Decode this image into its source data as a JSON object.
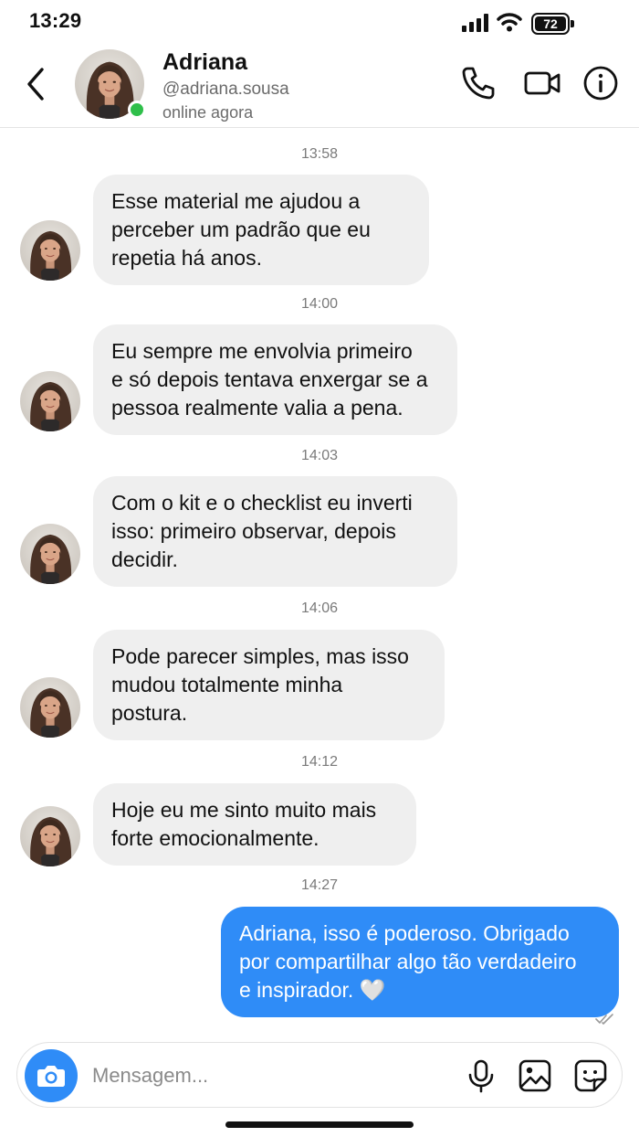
{
  "status_bar": {
    "time": "13:29",
    "battery": "72"
  },
  "header": {
    "name": "Adriana",
    "handle": "@adriana.sousa",
    "status": "online agora"
  },
  "messages": [
    {
      "time": "13:58",
      "direction": "in",
      "lines": [
        "Esse material me ajudou a",
        "perceber um padrão que eu",
        "repetia há anos."
      ]
    },
    {
      "time": "14:00",
      "direction": "in",
      "lines": [
        "Eu sempre me envolvia primeiro",
        "e só depois tentava enxergar se a",
        "pessoa realmente valia a pena."
      ]
    },
    {
      "time": "14:03",
      "direction": "in",
      "lines": [
        "Com o kit e o checklist eu inverti",
        "isso: primeiro observar, depois",
        "decidir."
      ]
    },
    {
      "time": "14:06",
      "direction": "in",
      "lines": [
        "Pode parecer simples, mas isso",
        "mudou totalmente minha",
        "postura."
      ]
    },
    {
      "time": "14:12",
      "direction": "in",
      "lines": [
        "Hoje eu me sinto muito mais",
        "forte emocionalmente."
      ]
    },
    {
      "time": "14:27",
      "direction": "out",
      "lines": [
        "Adriana, isso é poderoso. Obrigado",
        "por compartilhar algo tão verdadeiro",
        "e inspirador. 🤍"
      ]
    }
  ],
  "composer": {
    "placeholder": "Mensagem..."
  },
  "colors": {
    "accent": "#2f8cf7",
    "incoming_bubble": "#efefef",
    "online": "#2fbf4a"
  },
  "icons": [
    "back-icon",
    "phone-icon",
    "video-camera-icon",
    "info-icon",
    "camera-icon",
    "microphone-icon",
    "gallery-icon",
    "sticker-icon",
    "double-check-icon"
  ]
}
